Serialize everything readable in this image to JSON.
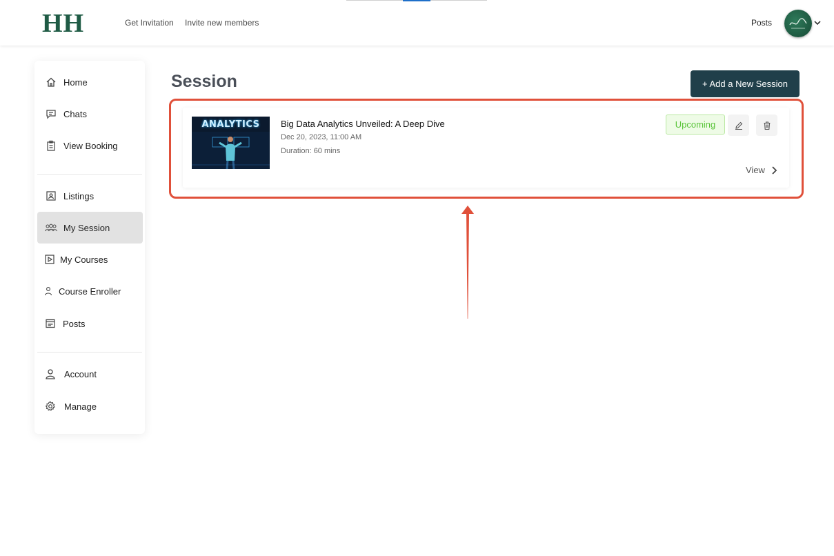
{
  "header": {
    "logo": "HH",
    "nav": [
      "Get Invitation",
      "Invite new members"
    ],
    "posts_label": "Posts",
    "avatar_icon": "user-avatar",
    "brand_color": "#1f5b45"
  },
  "sidebar": {
    "items": [
      {
        "label": "Home",
        "icon": "home-icon"
      },
      {
        "label": "Chats",
        "icon": "chat-icon"
      },
      {
        "label": "View Booking",
        "icon": "clipboard-icon"
      },
      {
        "label": "Listings",
        "icon": "listing-icon"
      },
      {
        "label": "My Session",
        "icon": "group-icon",
        "active": true
      },
      {
        "label": "My Courses",
        "icon": "play-square-icon"
      },
      {
        "label": "Course Enroller",
        "icon": "person-icon"
      },
      {
        "label": "Posts",
        "icon": "window-icon"
      },
      {
        "label": "Account",
        "icon": "user-icon"
      },
      {
        "label": "Manage",
        "icon": "gear-icon"
      }
    ]
  },
  "main": {
    "title": "Session",
    "add_button": "+ Add a New Session",
    "session": {
      "thumbnail_text": "ANALYTICS",
      "title": "Big Data Analytics Unveiled: A Deep Dive",
      "date": "Dec 20, 2023, 11:00 AM",
      "duration": "Duration: 60 mins",
      "status": "Upcoming",
      "view_label": "View"
    }
  },
  "colors": {
    "accent_button": "#203f4a",
    "highlight": "#e0503a",
    "status_green": "#5ac43a"
  }
}
